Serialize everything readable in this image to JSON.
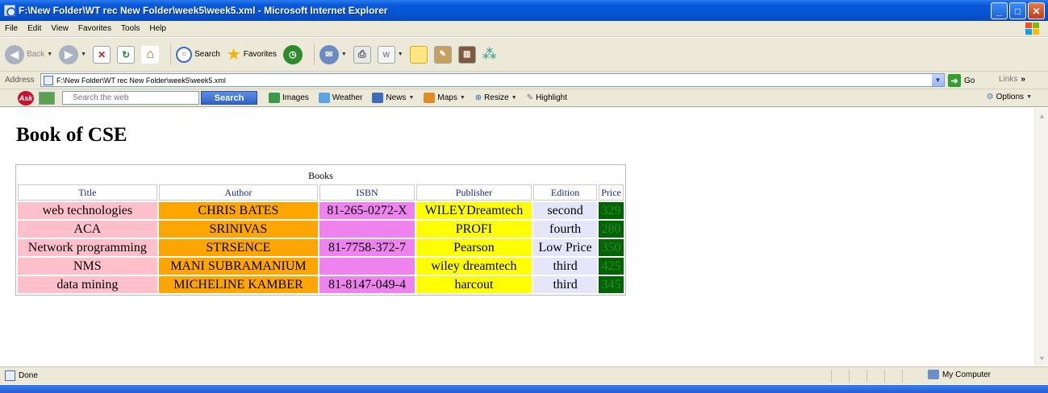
{
  "window": {
    "title": "F:\\New Folder\\WT rec New Folder\\week5\\week5.xml - Microsoft Internet Explorer",
    "buttons": [
      "minimize",
      "maximize",
      "close"
    ]
  },
  "menu": {
    "items": [
      "File",
      "Edit",
      "View",
      "Favorites",
      "Tools",
      "Help"
    ]
  },
  "toolbar": {
    "back_label": "Back",
    "search_label": "Search",
    "favorites_label": "Favorites"
  },
  "address": {
    "label": "Address",
    "url": "F:\\New Folder\\WT rec New Folder\\week5\\week5.xml",
    "go_label": "Go",
    "links_label": "Links"
  },
  "ask_toolbar": {
    "logo": "Ask",
    "search_placeholder": "Search the web",
    "search_button": "Search",
    "links": [
      "Images",
      "Weather",
      "News",
      "Maps",
      "Resize",
      "Highlight"
    ],
    "options_label": "Options"
  },
  "page": {
    "heading": "Book of CSE",
    "table": {
      "caption": "Books",
      "columns": [
        "Title",
        "Author",
        "ISBN",
        "Publisher",
        "Edition",
        "Price"
      ],
      "rows": [
        {
          "title": "web technologies",
          "author": "CHRIS BATES",
          "isbn": "81-265-0272-X",
          "publisher": "WILEYDreamtech",
          "edition": "second",
          "price": "329"
        },
        {
          "title": "ACA",
          "author": "SRINIVAS",
          "isbn": "",
          "publisher": "PROFI",
          "edition": "fourth",
          "price": "280"
        },
        {
          "title": "Network programming",
          "author": "STRSENCE",
          "isbn": "81-7758-372-7",
          "publisher": "Pearson",
          "edition": "Low Price",
          "price": "350"
        },
        {
          "title": "NMS",
          "author": "MANI SUBRAMANIUM",
          "isbn": "",
          "publisher": "wiley dreamtech",
          "edition": "third",
          "price": "425"
        },
        {
          "title": "data mining",
          "author": "MICHELINE KAMBER",
          "isbn": "81-8147-049-4",
          "publisher": "harcout",
          "edition": "third",
          "price": "345"
        }
      ]
    },
    "cell_colors": {
      "title": "#ffc0cb",
      "author": "#ffa500",
      "isbn": "#ee82ee",
      "publisher": "#ffff00",
      "edition": "#e6e6fa",
      "price": "#006400"
    }
  },
  "status": {
    "text": "Done",
    "zone": "My Computer"
  }
}
